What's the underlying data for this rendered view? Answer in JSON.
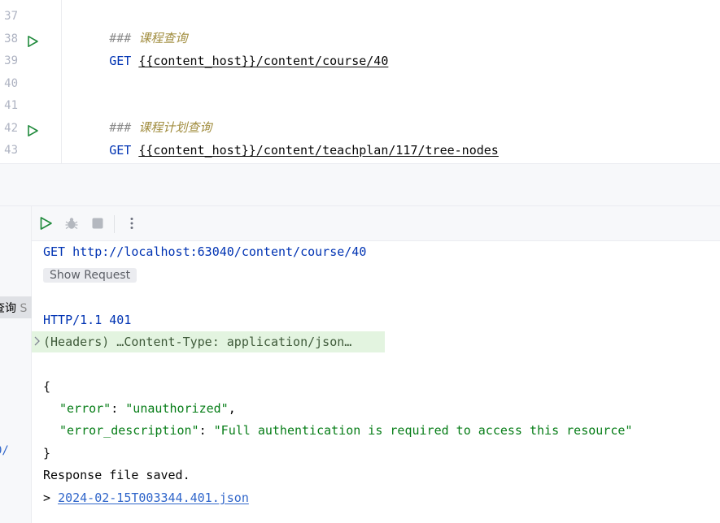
{
  "editor": {
    "lines": [
      {
        "number": "37",
        "hash": "###",
        "comment": "课程查询"
      },
      {
        "number": "38",
        "method": "GET",
        "url": "{{content_host}}/content/course/40"
      },
      {
        "number": "39"
      },
      {
        "number": "40"
      },
      {
        "number": "41",
        "hash": "###",
        "comment": "课程计划查询"
      },
      {
        "number": "42",
        "method": "GET",
        "url": "{{content_host}}/content/teachplan/117/tree-nodes"
      },
      {
        "number": "43"
      }
    ],
    "run_icon": "run-triangle-icon"
  },
  "sidebar": {
    "selected_text": "查询",
    "selected_suffix": "S",
    "link_fragment": "0/"
  },
  "toolbar": {
    "icons": [
      "run-icon",
      "debug-icon",
      "stop-icon",
      "more-vertical-icon"
    ]
  },
  "console": {
    "request_line": "GET http://localhost:63040/content/course/40",
    "show_request_label": "Show Request",
    "status_line": "HTTP/1.1 401",
    "headers_summary": "(Headers) …Content-Type: application/json…",
    "json_open": "{",
    "json_close": "}",
    "body": [
      {
        "key": "\"error\"",
        "value": "\"unauthorized\"",
        "trail": ","
      },
      {
        "key": "\"error_description\"",
        "value": "\"Full authentication is required to access this resource\"",
        "trail": ""
      }
    ],
    "saved_text": "Response file saved.",
    "file_prefix": "> ",
    "file_link": "2024-02-15T003344.401.json"
  },
  "colors": {
    "keyword": "#0033b3",
    "comment_cn": "#a18d3f",
    "json_string": "#067d17",
    "link": "#2f65ca",
    "run_green": "#208a3c",
    "headers_bg": "#e3f4e0"
  }
}
